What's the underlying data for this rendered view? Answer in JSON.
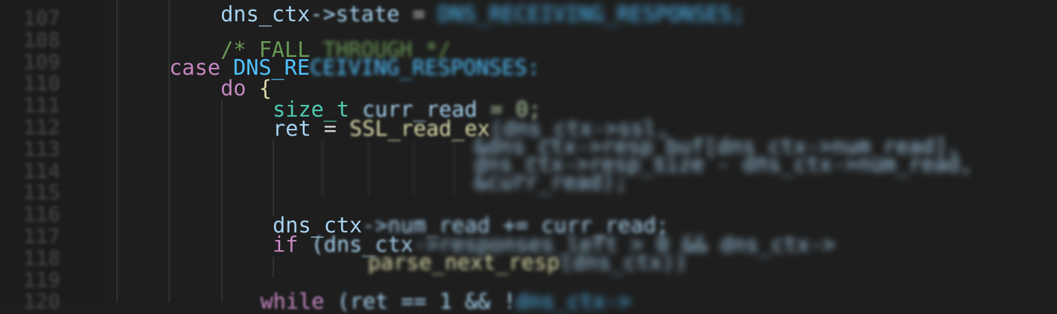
{
  "editor": {
    "line_numbers": [
      "107",
      "108",
      "109",
      "110",
      "111",
      "112",
      "113",
      "114",
      "115",
      "116",
      "117",
      "118",
      "119",
      "120"
    ],
    "code": {
      "l107": {
        "a": "dns_ctx",
        "b": "->state",
        "c": " = ",
        "d": "DNS_RECEIVING_RESPONSES;"
      },
      "l108": {
        "a": "/* FALL ",
        "b": "THROUGH */"
      },
      "l109": {
        "a": "case",
        "b": " DNS_RE",
        "c": "CEIVING_RESPONSES:"
      },
      "l110": {
        "a": "do",
        "b": " {"
      },
      "l111": {
        "a": "size_t",
        "b": " curr_read",
        "c": " = 0;"
      },
      "l112": {
        "a": "ret",
        "b": " = ",
        "c": "SSL_read_ex",
        "d": "(dns_ctx->ssl,"
      },
      "l113": {
        "a": "&dns_ctx->resp_buf[dns_ctx->num_read],"
      },
      "l114": {
        "a": "dns_ctx->resp_size - dns_ctx->num_read,"
      },
      "l115": {
        "a": "&curr_read);"
      },
      "l116": {
        "a": "dns_ctx",
        "b": "->num_read += curr_read;"
      },
      "l117": {
        "a": "if",
        "b": " (dns_ctx",
        "c": "->responses_left > 0 && dns_ctx->"
      },
      "l118": {
        "a": "parse_next_resp",
        "b": "(dns_ctx))"
      },
      "l119": {
        "a": "while",
        "b": " (ret == 1 && !",
        "c": "dns_ctx->"
      }
    }
  },
  "colors": {
    "background": "#1e1e1e",
    "keyword": "#c586c0",
    "variable": "#a6d2ef",
    "comment": "#6a9955",
    "type": "#4ec9b0",
    "function": "#dcdcaa"
  }
}
